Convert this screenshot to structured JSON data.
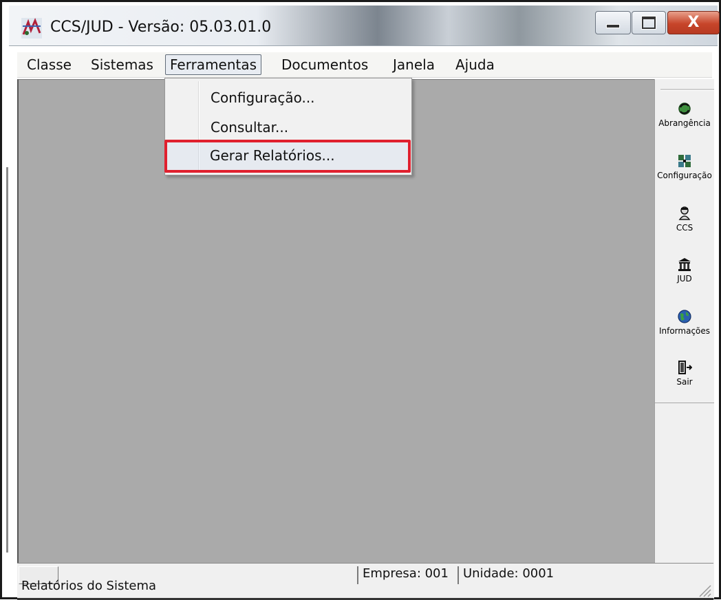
{
  "window": {
    "title": "CCS/JUD - Versão: 05.03.01.0",
    "close_glyph": "X",
    "accent_color": "#e0202e"
  },
  "menubar": {
    "items": [
      {
        "label": "Classe"
      },
      {
        "label": "Sistemas"
      },
      {
        "label": "Ferramentas",
        "active": true
      },
      {
        "label": "Documentos"
      },
      {
        "label": "Janela"
      },
      {
        "label": "Ajuda"
      }
    ]
  },
  "dropdown": {
    "items": [
      {
        "label": "Configuração..."
      },
      {
        "label": "Consultar..."
      },
      {
        "label": "Gerar Relatórios...",
        "highlighted": true
      }
    ]
  },
  "toolbar": {
    "items": [
      {
        "label": "Abrangência",
        "icon": "refresh-globe-icon"
      },
      {
        "label": "Configuração",
        "icon": "grid-config-icon"
      },
      {
        "label": "CCS",
        "icon": "person-icon"
      },
      {
        "label": "JUD",
        "icon": "courthouse-icon"
      },
      {
        "label": "Informações",
        "icon": "globe-icon"
      },
      {
        "label": "Sair",
        "icon": "exit-door-icon"
      }
    ]
  },
  "statusbar": {
    "message": "Relatórios do Sistema",
    "empresa": "Empresa: 001",
    "unidade": "Unidade: 0001"
  }
}
